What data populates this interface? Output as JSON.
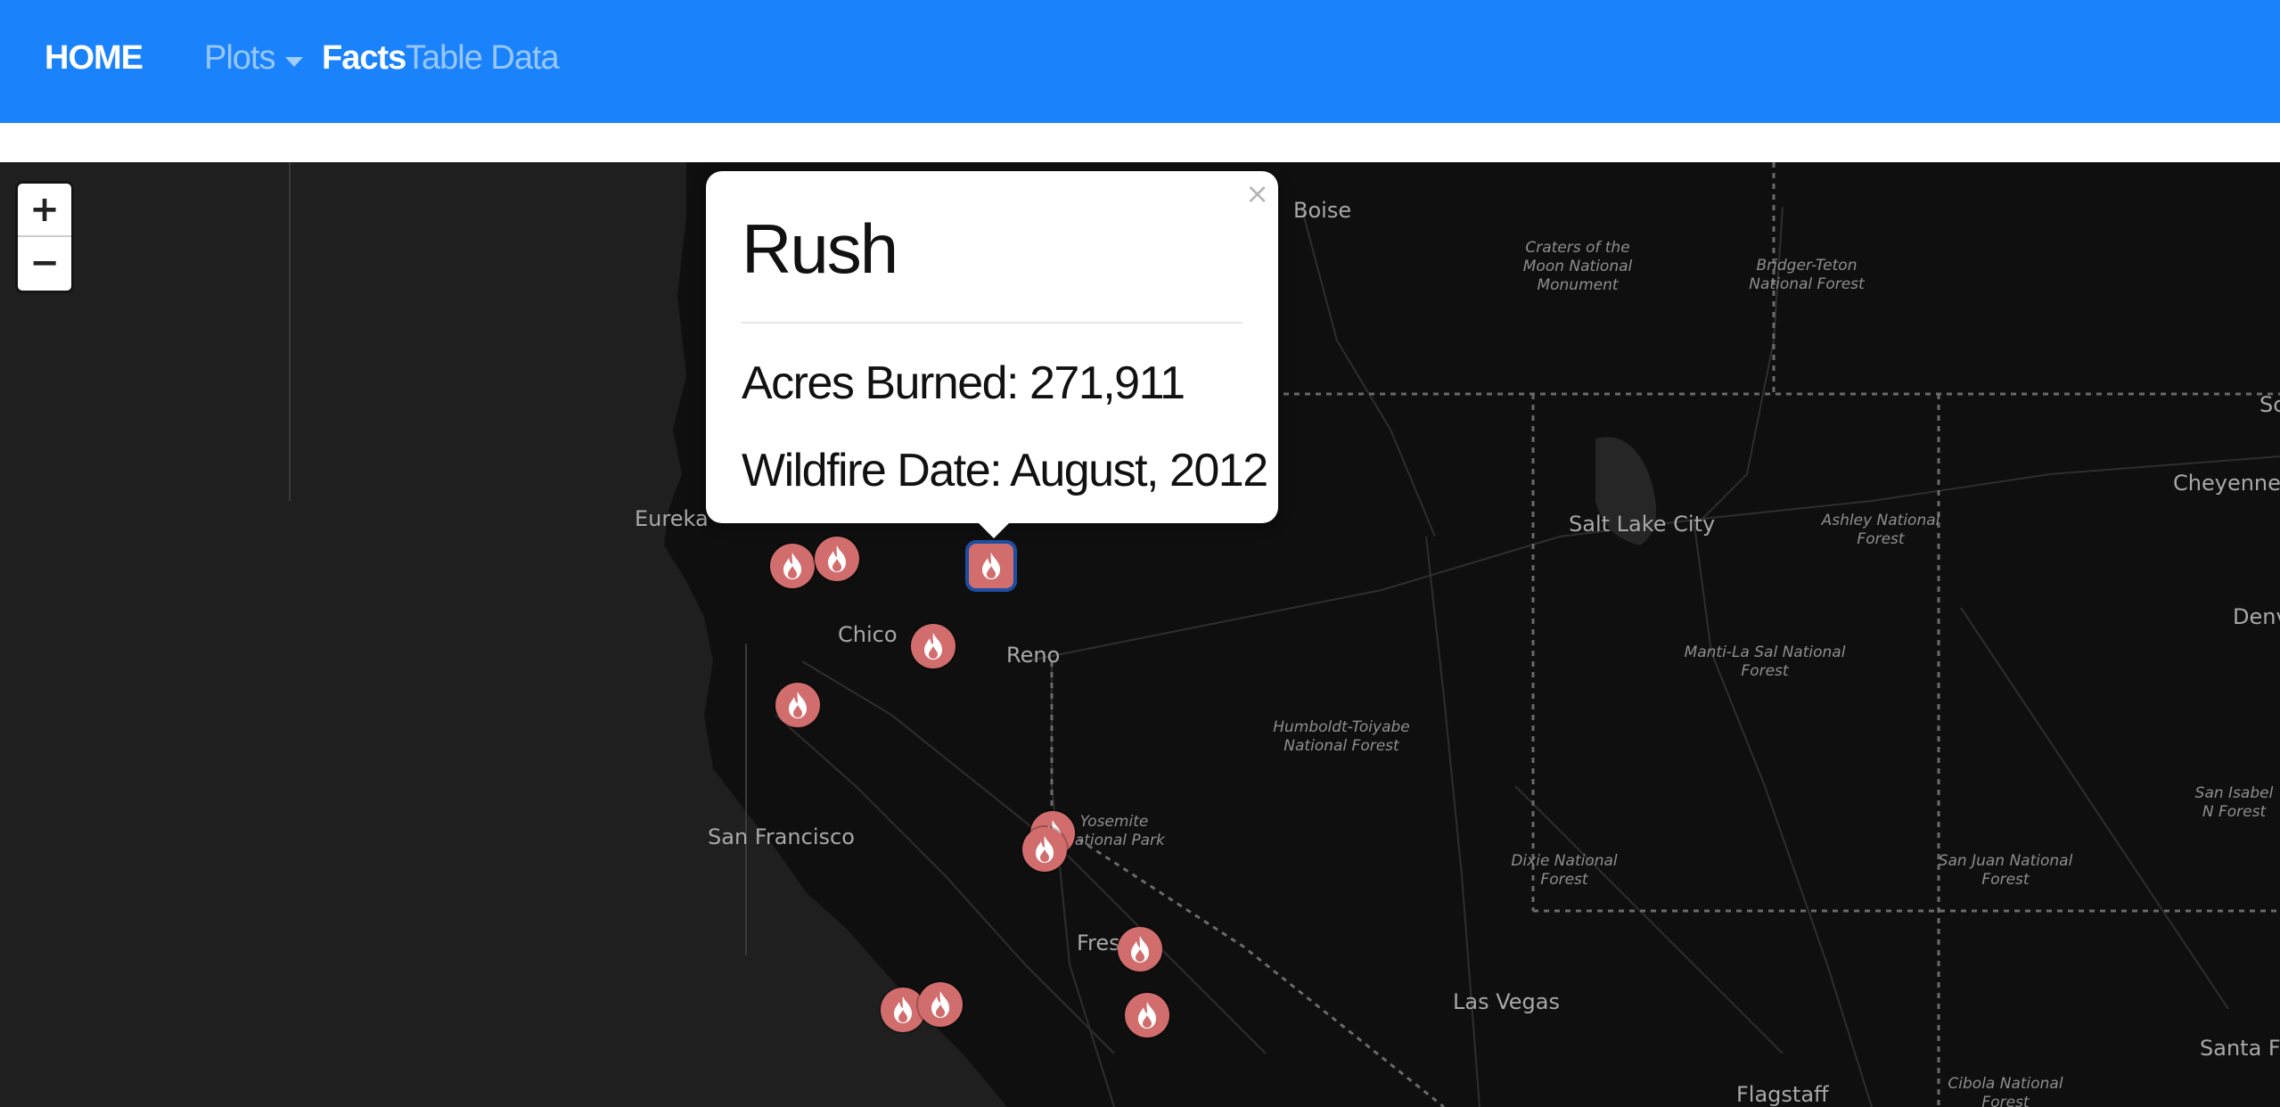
{
  "navbar": {
    "brand": "HOME",
    "links": [
      {
        "label": "Plots",
        "active": false,
        "dropdown": true
      },
      {
        "label": "Facts",
        "active": true
      },
      {
        "label": "Table Data",
        "active": false
      }
    ],
    "color": "#1a82fb"
  },
  "map": {
    "zoom_in_label": "+",
    "zoom_out_label": "−",
    "base_color": "#1c1c1c",
    "cities": [
      "Boise",
      "Eureka",
      "Chico",
      "Reno",
      "Salt Lake City",
      "Cheyenne",
      "San Francisco",
      "Fres",
      "Las Vegas",
      "Flagstaff",
      "Santa Fe",
      "Denv",
      "Sc"
    ],
    "forests": [
      "Craters of the Moon National Monument",
      "Bridger-Teton National Forest",
      "Ashley National Forest",
      "Manti-La Sal National Forest",
      "Humboldt-Toiyabe National Forest",
      "Dixie National Forest",
      "San Juan National Forest",
      "San Isabel N Forest",
      "Cibola National Forest",
      "Yosemite National Park"
    ],
    "marker_color": "#d26d6d",
    "marker_icon": "fire-icon",
    "marker_count": 13
  },
  "popup": {
    "title": "Rush",
    "acres_line": "Acres Burned: 271,911",
    "date_line": "Wildfire Date: August, 2012",
    "close_label": "×"
  }
}
